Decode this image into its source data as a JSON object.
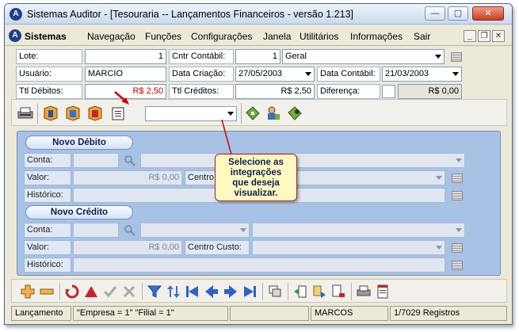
{
  "window": {
    "title": "Sistemas Auditor - [Tesouraria -- Lançamentos Financeiros - versão 1.213]",
    "app_icon": "auditor-logo-icon"
  },
  "menu": {
    "items": [
      "Sistemas",
      "Navegação",
      "Funções",
      "Configurações",
      "Janela",
      "Utilitários",
      "Informações",
      "Sair"
    ]
  },
  "header": {
    "lote_label": "Lote:",
    "lote_value": "1",
    "cntr_contabil_label": "Cntr Contábil:",
    "cntr_contabil_number": "1",
    "cntr_contabil_name": "Geral",
    "usuario_label": "Usuário:",
    "usuario_value": "MARCIO",
    "data_criacao_label": "Data Criação:",
    "data_criacao_value": "27/05/2003",
    "data_contabil_label": "Data Contábil:",
    "data_contabil_value": "21/03/2003",
    "ttl_debitos_label": "Ttl Débitos:",
    "ttl_debitos_value": "R$ 2,50",
    "ttl_creditos_label": "Ttl Créditos:",
    "ttl_creditos_value": "R$ 2,50",
    "diferenca_label": "Diferença:",
    "diferenca_value": "R$ 0,00"
  },
  "toolbar": {
    "integrations_combo_value": "",
    "icons": [
      "printer-icon",
      "integration-icon",
      "integration-icon",
      "integration-icon",
      "integration-icon",
      "tag-icon",
      "user-tag-icon",
      "diamond-tag-icon"
    ]
  },
  "debito": {
    "title": "Novo Débito",
    "conta_label": "Conta:",
    "valor_label": "Valor:",
    "valor_value": "R$ 0,00",
    "centro_label": "Centro C",
    "historico_label": "Histórico:"
  },
  "credito": {
    "title": "Novo Crédito",
    "conta_label": "Conta:",
    "valor_label": "Valor:",
    "valor_value": "R$ 0,00",
    "centro_label": "Centro Custo:",
    "historico_label": "Histórico:"
  },
  "tooltip": {
    "lines": [
      "Selecione as",
      "integrações",
      "que deseja",
      "visualizar."
    ]
  },
  "statusbar": {
    "mode": "Lançamento",
    "filter": "\"Empresa = 1\"  \"Filial = 1\"",
    "user": "MARCOS",
    "records": "1/7029 Registros"
  },
  "colors": {
    "panel_bg": "#a8c2e6",
    "red_value": "#cc0000",
    "tooltip_bg": "#fff8c0",
    "arrow": "#d00000"
  }
}
